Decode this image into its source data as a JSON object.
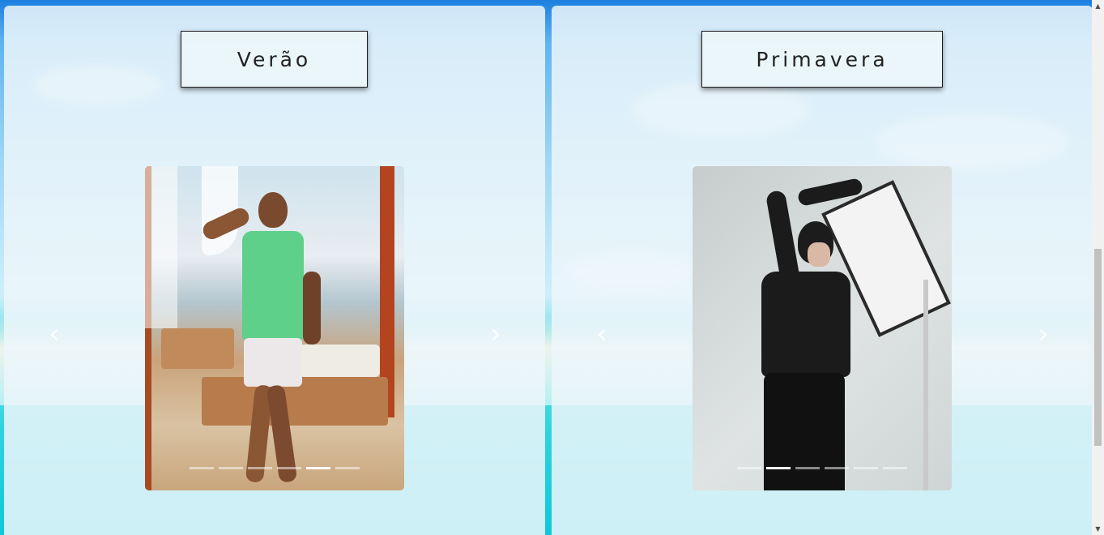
{
  "panels": [
    {
      "title": "Verão",
      "indicators": 6,
      "active_indicator": 4
    },
    {
      "title": "Primavera",
      "indicators": 6,
      "active_indicator": 1
    }
  ],
  "icons": {
    "prev": "chevron-left-icon",
    "next": "chevron-right-icon"
  },
  "arrows": {
    "prev": "‹",
    "next": "›"
  },
  "scrollbar": {
    "up": "▲",
    "down": "▼"
  }
}
